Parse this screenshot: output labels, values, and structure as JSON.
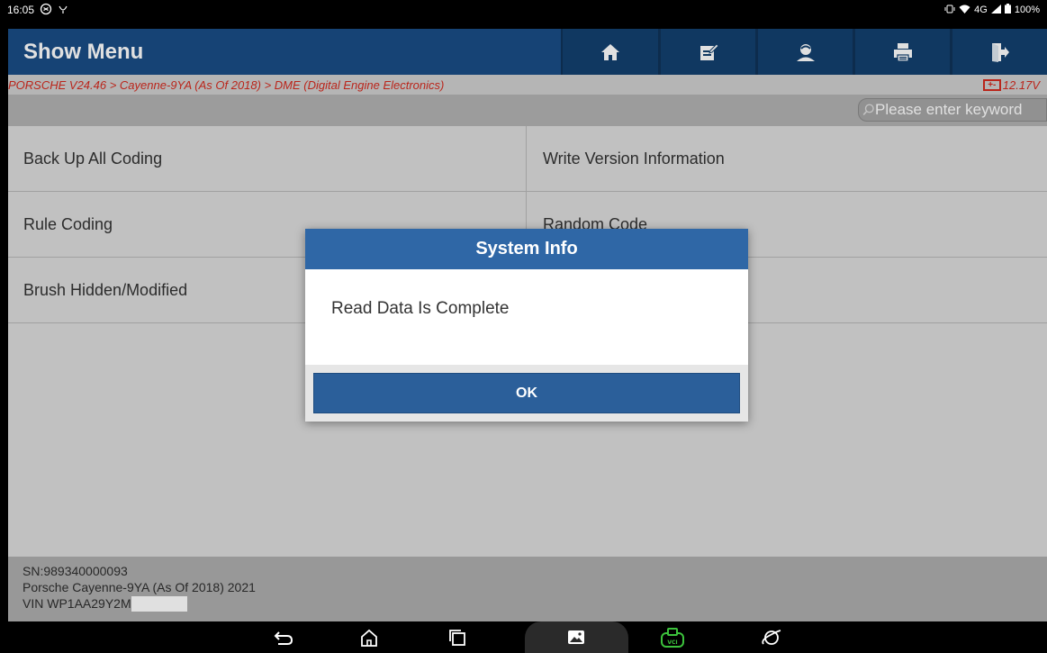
{
  "status_bar": {
    "time": "16:05",
    "signal": "4G",
    "battery": "100%"
  },
  "header": {
    "title": "Show Menu",
    "toolbar": [
      {
        "icon": "home-icon"
      },
      {
        "icon": "edit-icon"
      },
      {
        "icon": "user-icon"
      },
      {
        "icon": "print-icon"
      },
      {
        "icon": "exit-icon"
      }
    ]
  },
  "breadcrumb": {
    "path": "PORSCHE V24.46 > Cayenne-9YA (As Of 2018) > DME (Digital Engine Electronics)",
    "voltage": "12.17V",
    "battery_icon_text": "+-"
  },
  "search": {
    "placeholder": "Please enter keyword"
  },
  "menu": {
    "items": [
      {
        "label": "Back Up All Coding"
      },
      {
        "label": "Write Version Information"
      },
      {
        "label": "Rule Coding"
      },
      {
        "label": "Random Code"
      },
      {
        "label": "Brush Hidden/Modified"
      },
      {
        "label": ""
      }
    ]
  },
  "footer": {
    "sn": "SN:989340000093",
    "vehicle": "Porsche Cayenne-9YA (As Of 2018) 2021",
    "vin": "VIN WP1AA29Y2M"
  },
  "dialog": {
    "title": "System Info",
    "message": "Read Data Is Complete",
    "ok_label": "OK"
  },
  "colors": {
    "header_bg": "#1a4d86",
    "toolbar_btn": "#13406f",
    "breadcrumb_text": "#d42b1f",
    "dialog_title_bg": "#2f67a6",
    "ok_button_bg": "#2b5f9a",
    "vci_icon": "#3cc23c"
  }
}
